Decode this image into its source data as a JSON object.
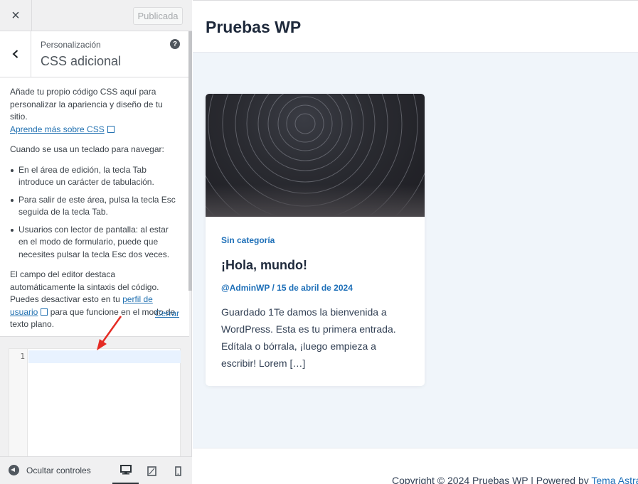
{
  "customizer": {
    "close_icon": "×",
    "published_label": "Publicada",
    "breadcrumb": "Personalización",
    "section_title": "CSS adicional",
    "help_icon": "?",
    "desc_intro_1": "Añade tu propio código CSS aquí para personalizar la apariencia y diseño de tu sitio.",
    "desc_learn_link": "Aprende más sobre CSS",
    "desc_keyboard": "Cuando se usa un teclado para navegar:",
    "bullets": [
      "En el área de edición, la tecla Tab introduce un carácter de tabulación.",
      "Para salir de este área, pulsa la tecla Esc seguida de la tecla Tab.",
      "Usuarios con lector de pantalla: al estar en el modo de formulario, puede que necesites pulsar la tecla Esc dos veces."
    ],
    "desc_highlight_1": "El campo del editor destaca automáticamente la sintaxis del código. Puedes desactivar esto en tu",
    "desc_profile_link": "perfil de usuario",
    "desc_highlight_2": "para que funcione en el modo de texto plano.",
    "close_link": "Cerrar",
    "editor_line_number": "1",
    "hide_controls_label": "Ocultar controles"
  },
  "preview": {
    "site_title": "Pruebas WP",
    "post": {
      "category": "Sin categoría",
      "title": "¡Hola, mundo!",
      "meta": "@AdminWP / 15 de abril de 2024",
      "excerpt": "Guardado 1Te damos la bienvenida a WordPress. Esta es tu primera entrada. Edítala o bórrala, ¡luego empieza a escribir! Lorem […]"
    },
    "footer_text": "Copyright © 2024 Pruebas WP | Powered by ",
    "footer_link": "Tema Astra"
  },
  "colors": {
    "link": "#2271b1",
    "accent": "#1d6fb8",
    "annotation_arrow": "#e52b24"
  }
}
